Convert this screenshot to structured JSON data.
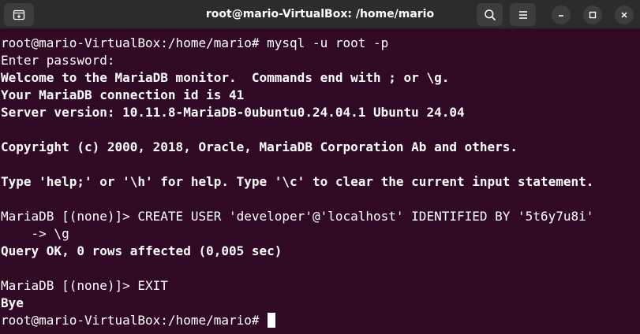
{
  "window": {
    "title": "root@mario-VirtualBox: /home/mario",
    "icons": {
      "new_tab": "new-tab-icon",
      "search": "search-icon",
      "menu": "hamburger-menu-icon",
      "minimize": "minimize-icon",
      "maximize": "maximize-icon",
      "close": "close-icon"
    }
  },
  "terminal": {
    "colors": {
      "background": "#300a24",
      "foreground": "#ffffff"
    },
    "lines": [
      "root@mario-VirtualBox:/home/mario# mysql -u root -p",
      "Enter password:",
      "Welcome to the MariaDB monitor.  Commands end with ; or \\g.",
      "Your MariaDB connection id is 41",
      "Server version: 10.11.8-MariaDB-0ubuntu0.24.04.1 Ubuntu 24.04",
      "",
      "Copyright (c) 2000, 2018, Oracle, MariaDB Corporation Ab and others.",
      "",
      "Type 'help;' or '\\h' for help. Type '\\c' to clear the current input statement.",
      "",
      "MariaDB [(none)]> CREATE USER 'developer'@'localhost' IDENTIFIED BY '5t6y7u8i'",
      "    -> \\g",
      "Query OK, 0 rows affected (0,005 sec)",
      "",
      "MariaDB [(none)]> EXIT",
      "Bye"
    ],
    "prompt": "root@mario-VirtualBox:/home/mario#"
  }
}
